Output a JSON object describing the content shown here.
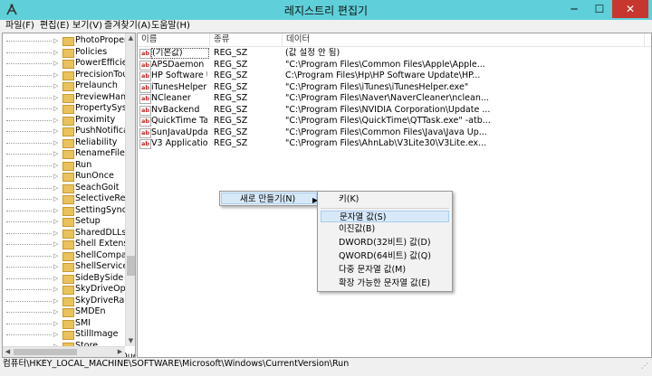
{
  "window": {
    "title": "레지스트리 편집기",
    "min": "─",
    "max": "☐",
    "close": "✕"
  },
  "menu": [
    "파일(F)",
    "편집(E)",
    "보기(V)",
    "즐겨찾기(A)",
    "도움말(H)"
  ],
  "tree": {
    "expander": "▷",
    "items": [
      "PhotoPropertyH",
      "Policies",
      "PowerEfficiency",
      "PrecisionTouchP",
      "Prelaunch",
      "PreviewHandler",
      "PropertySystem",
      "Proximity",
      "PushNotification",
      "Reliability",
      "RenameFiles",
      "Run",
      "RunOnce",
      "SeachGoit",
      "SelectiveRemote",
      "SettingSync",
      "Setup",
      "SharedDLLs",
      "Shell Extensions",
      "ShellCompatibil",
      "ShellServiceObj",
      "SideBySide",
      "SkyDriveOptIn",
      "SkyDriveRamps",
      "SMDEn",
      "SMI",
      "StillImage",
      "Store",
      "StructuredQuer"
    ]
  },
  "list": {
    "columns": {
      "name": "이름",
      "type": "종류",
      "data": "데이터"
    },
    "icon": "ab",
    "rows": [
      {
        "name": "(기본값)",
        "type": "REG_SZ",
        "data": "(값 설정 안 됨)"
      },
      {
        "name": "APSDaemon",
        "type": "REG_SZ",
        "data": "\"C:\\Program Files\\Common Files\\Apple\\Apple..."
      },
      {
        "name": "HP Software Up...",
        "type": "REG_SZ",
        "data": "C:\\Program Files\\Hp\\HP Software Update\\HP..."
      },
      {
        "name": "iTunesHelper",
        "type": "REG_SZ",
        "data": "\"C:\\Program Files\\iTunes\\iTunesHelper.exe\""
      },
      {
        "name": "NCleaner",
        "type": "REG_SZ",
        "data": "\"C:\\Program Files\\Naver\\NaverCleaner\\nclean..."
      },
      {
        "name": "NvBackend",
        "type": "REG_SZ",
        "data": "\"C:\\Program Files\\NVIDIA Corporation\\Update ..."
      },
      {
        "name": "QuickTime Task",
        "type": "REG_SZ",
        "data": "\"C:\\Program Files\\QuickTime\\QTTask.exe\" -atb..."
      },
      {
        "name": "SunJavaUpdate...",
        "type": "REG_SZ",
        "data": "\"C:\\Program Files\\Common Files\\Java\\Java Up..."
      },
      {
        "name": "V3 Application",
        "type": "REG_SZ",
        "data": "\"C:\\Program Files\\AhnLab\\V3Lite30\\V3Lite.ex..."
      }
    ]
  },
  "context_menu": {
    "new_label": "새로 만들기(N)",
    "arrow": "▶",
    "submenu": [
      "키(K)",
      "문자열 값(S)",
      "이진값(B)",
      "DWORD(32비트) 값(D)",
      "QWORD(64비트) 값(Q)",
      "다중 문자열 값(M)",
      "확장 가능한 문자열 값(E)"
    ]
  },
  "status": "컴퓨터\\HKEY_LOCAL_MACHINE\\SOFTWARE\\Microsoft\\Windows\\CurrentVersion\\Run"
}
